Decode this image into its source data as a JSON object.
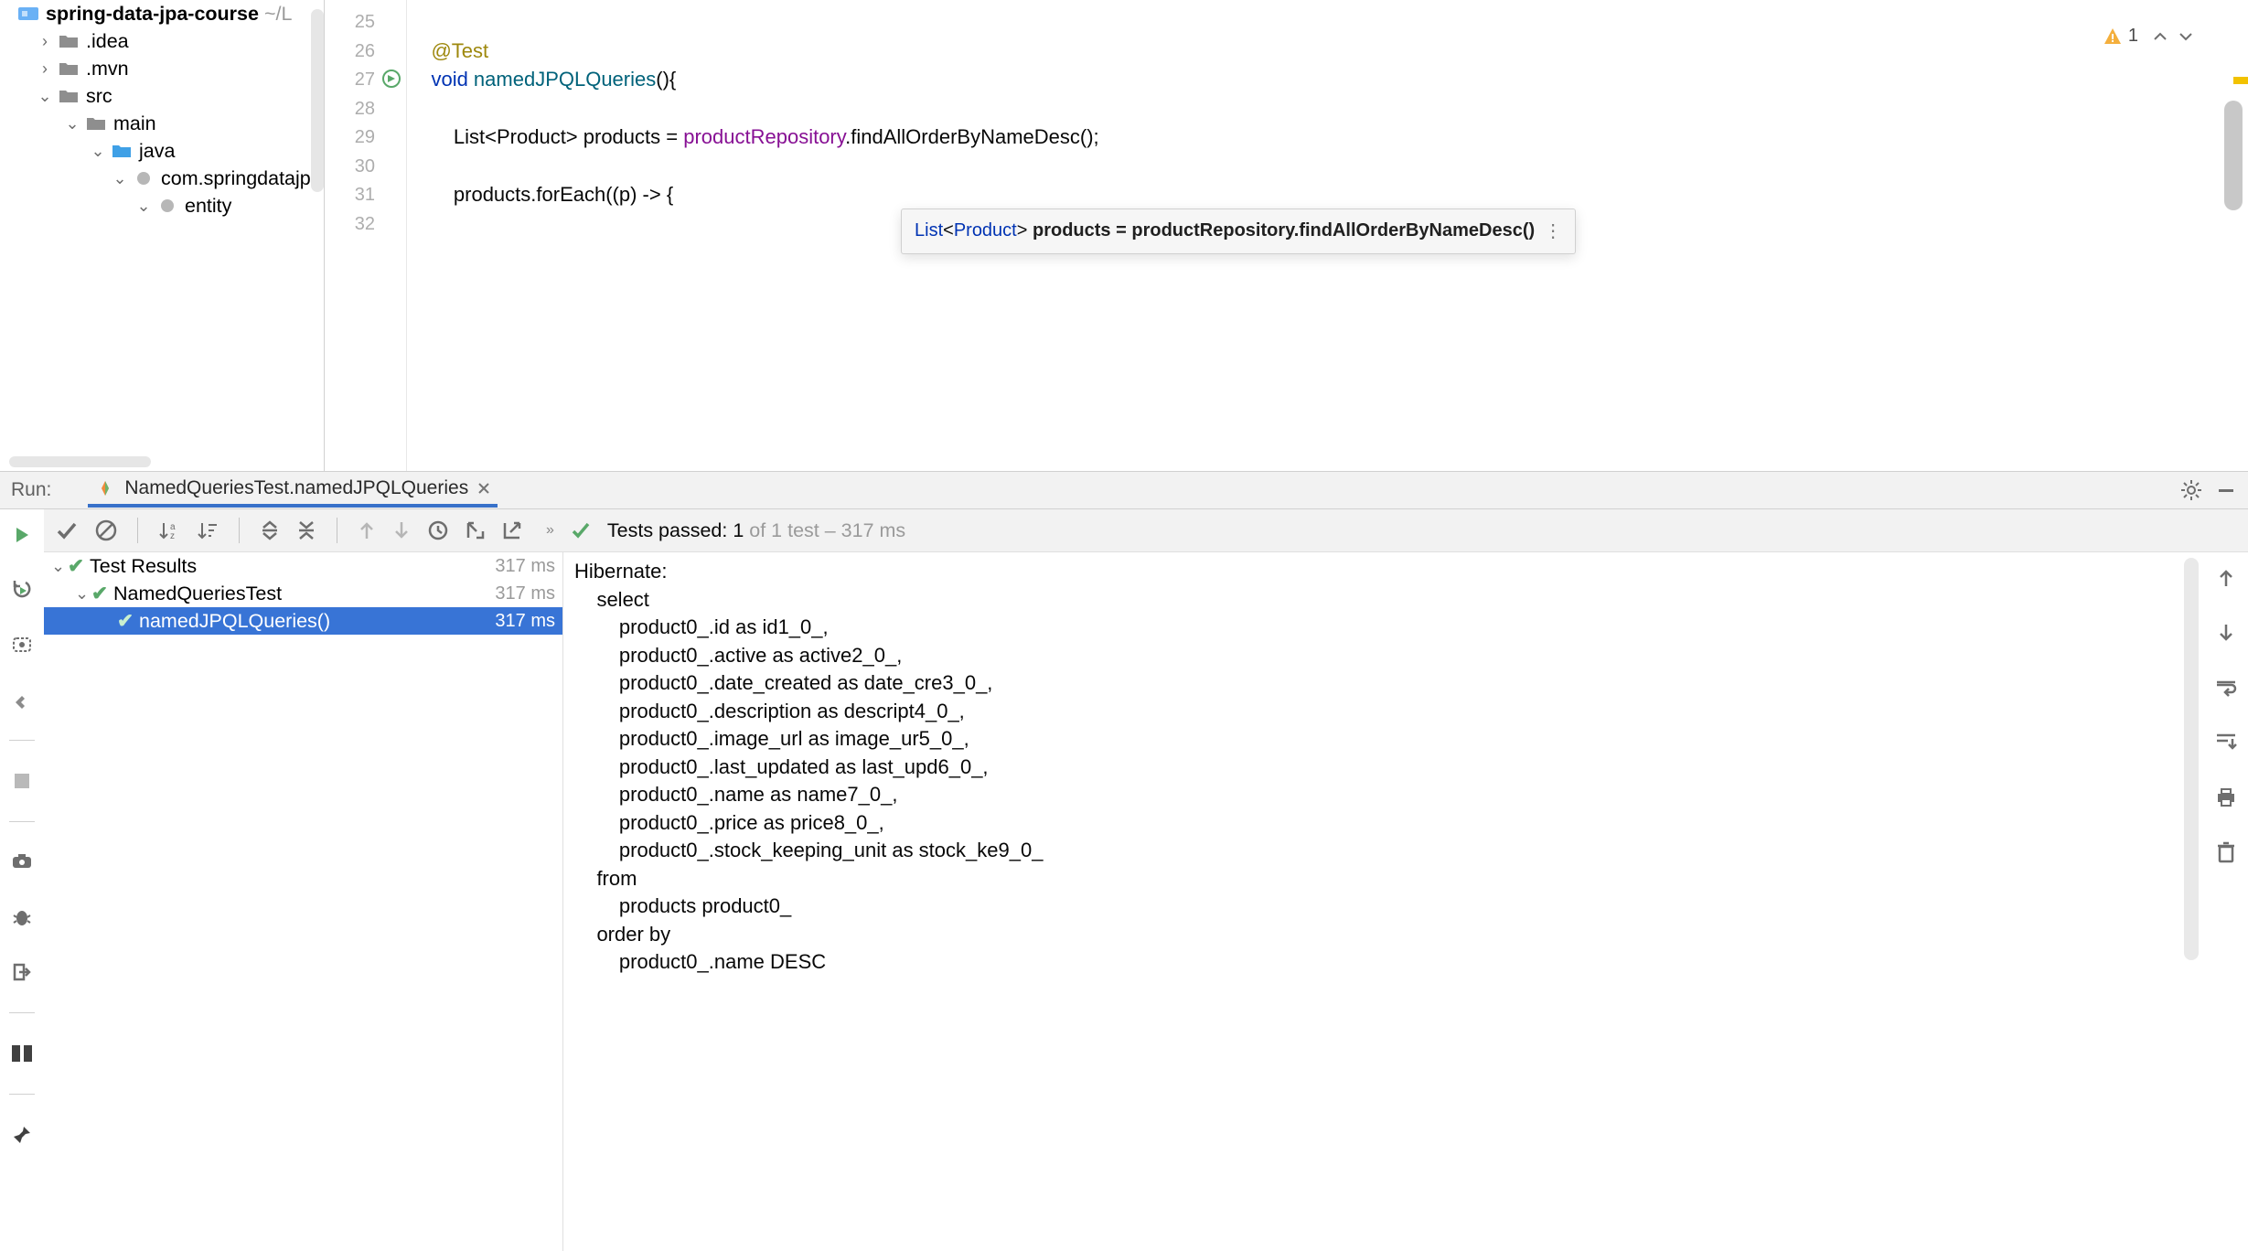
{
  "warning_count": "1",
  "project_tree": {
    "root": "spring-data-jpa-course",
    "root_suffix": "~/L",
    "items": [
      {
        "label": ".idea",
        "indent": 40,
        "collapsed": true,
        "kind": "folder-gray"
      },
      {
        "label": ".mvn",
        "indent": 40,
        "collapsed": true,
        "kind": "folder-gray"
      },
      {
        "label": "src",
        "indent": 40,
        "collapsed": false,
        "kind": "folder-gray"
      },
      {
        "label": "main",
        "indent": 70,
        "collapsed": false,
        "kind": "folder-gray"
      },
      {
        "label": "java",
        "indent": 98,
        "collapsed": false,
        "kind": "folder-blue"
      },
      {
        "label": "com.springdatajp",
        "indent": 122,
        "collapsed": false,
        "kind": "pkg"
      },
      {
        "label": "entity",
        "indent": 148,
        "collapsed": false,
        "kind": "pkg"
      }
    ]
  },
  "editor": {
    "line_numbers": [
      "25",
      "26",
      "27",
      "28",
      "29",
      "30",
      "31",
      "32"
    ],
    "code": {
      "l1": "",
      "l2_ann": "@Test",
      "l3_kw": "void",
      "l3_name": " namedJPQLQueries",
      "l3_rest": "(){",
      "l4": "",
      "l5_pre": "        List<Product> products = ",
      "l5_field": "productRepository",
      "l5_rest": ".findAllOrderByNameDesc();",
      "l6": "",
      "l7": "        products.forEach((p) -> {",
      "l8": ""
    },
    "tooltip": {
      "k1": "List",
      "k2": "<",
      "k3": "Product",
      "k4": "> ",
      "bold": "products = productRepository.findAllOrderByNameDesc()"
    }
  },
  "run": {
    "label": "Run:",
    "tab_title": "NamedQueriesTest.namedJPQLQueries",
    "status_prefix": "Tests passed: 1",
    "status_suffix": " of 1 test – 317 ms"
  },
  "test_tree": {
    "r1_name": "Test Results",
    "r1_time": "317 ms",
    "r2_name": "NamedQueriesTest",
    "r2_time": "317 ms",
    "r3_name": "namedJPQLQueries()",
    "r3_time": "317 ms"
  },
  "console_out": "Hibernate: \n    select\n        product0_.id as id1_0_,\n        product0_.active as active2_0_,\n        product0_.date_created as date_cre3_0_,\n        product0_.description as descript4_0_,\n        product0_.image_url as image_ur5_0_,\n        product0_.last_updated as last_upd6_0_,\n        product0_.name as name7_0_,\n        product0_.price as price8_0_,\n        product0_.stock_keeping_unit as stock_ke9_0_ \n    from\n        products product0_ \n    order by\n        product0_.name DESC"
}
